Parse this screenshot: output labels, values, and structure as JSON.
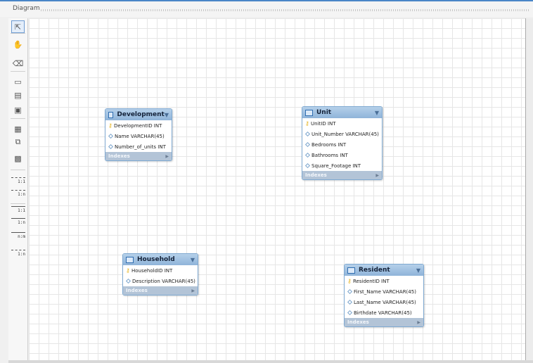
{
  "panel": {
    "title": "Diagram"
  },
  "toolbar": {
    "tools": [
      {
        "icon": "pointer-icon",
        "glyph": "⇱",
        "selected": true
      },
      {
        "icon": "hand-icon",
        "glyph": "✋"
      },
      {
        "icon": "eraser-icon",
        "glyph": "⌫"
      },
      {
        "icon": "layer-icon",
        "glyph": "▭"
      },
      {
        "icon": "note-icon",
        "glyph": "▤"
      },
      {
        "icon": "image-icon",
        "glyph": "▣"
      },
      {
        "icon": "table-icon",
        "glyph": "▦"
      },
      {
        "icon": "view-icon",
        "glyph": "⧉"
      },
      {
        "icon": "routine-group-icon",
        "glyph": "▩"
      }
    ],
    "relationships": [
      {
        "label": "1:1",
        "dashed": true
      },
      {
        "label": "1:n",
        "dashed": true
      },
      {
        "label": "1:1",
        "dashed": false
      },
      {
        "label": "1:n",
        "dashed": false
      },
      {
        "label": "n:m",
        "dashed": false
      },
      {
        "label": "1:n",
        "dashed": true
      }
    ]
  },
  "tables": [
    {
      "name": "Development",
      "columns": [
        {
          "text": "DevelopmentID INT",
          "pk": true
        },
        {
          "text": "Name VARCHAR(45)",
          "pk": false
        },
        {
          "text": "Number_of_units INT",
          "pk": false
        }
      ],
      "indexes_label": "Indexes"
    },
    {
      "name": "Unit",
      "columns": [
        {
          "text": "UnitID INT",
          "pk": true
        },
        {
          "text": "Unit_Number VARCHAR(45)",
          "pk": false
        },
        {
          "text": "Bedrooms INT",
          "pk": false
        },
        {
          "text": "Bathrooms INT",
          "pk": false
        },
        {
          "text": "Square_Footage INT",
          "pk": false
        }
      ],
      "indexes_label": "Indexes"
    },
    {
      "name": "Household",
      "columns": [
        {
          "text": "HouseholdID INT",
          "pk": true
        },
        {
          "text": "Description VARCHAR(45)",
          "pk": false
        }
      ],
      "indexes_label": "Indexes"
    },
    {
      "name": "Resident",
      "columns": [
        {
          "text": "ResidentID INT",
          "pk": true
        },
        {
          "text": "First_Name VARCHAR(45)",
          "pk": false
        },
        {
          "text": "Last_Name VARCHAR(45)",
          "pk": false
        },
        {
          "text": "Birthdate VARCHAR(45)",
          "pk": false
        }
      ],
      "indexes_label": "Indexes"
    }
  ]
}
